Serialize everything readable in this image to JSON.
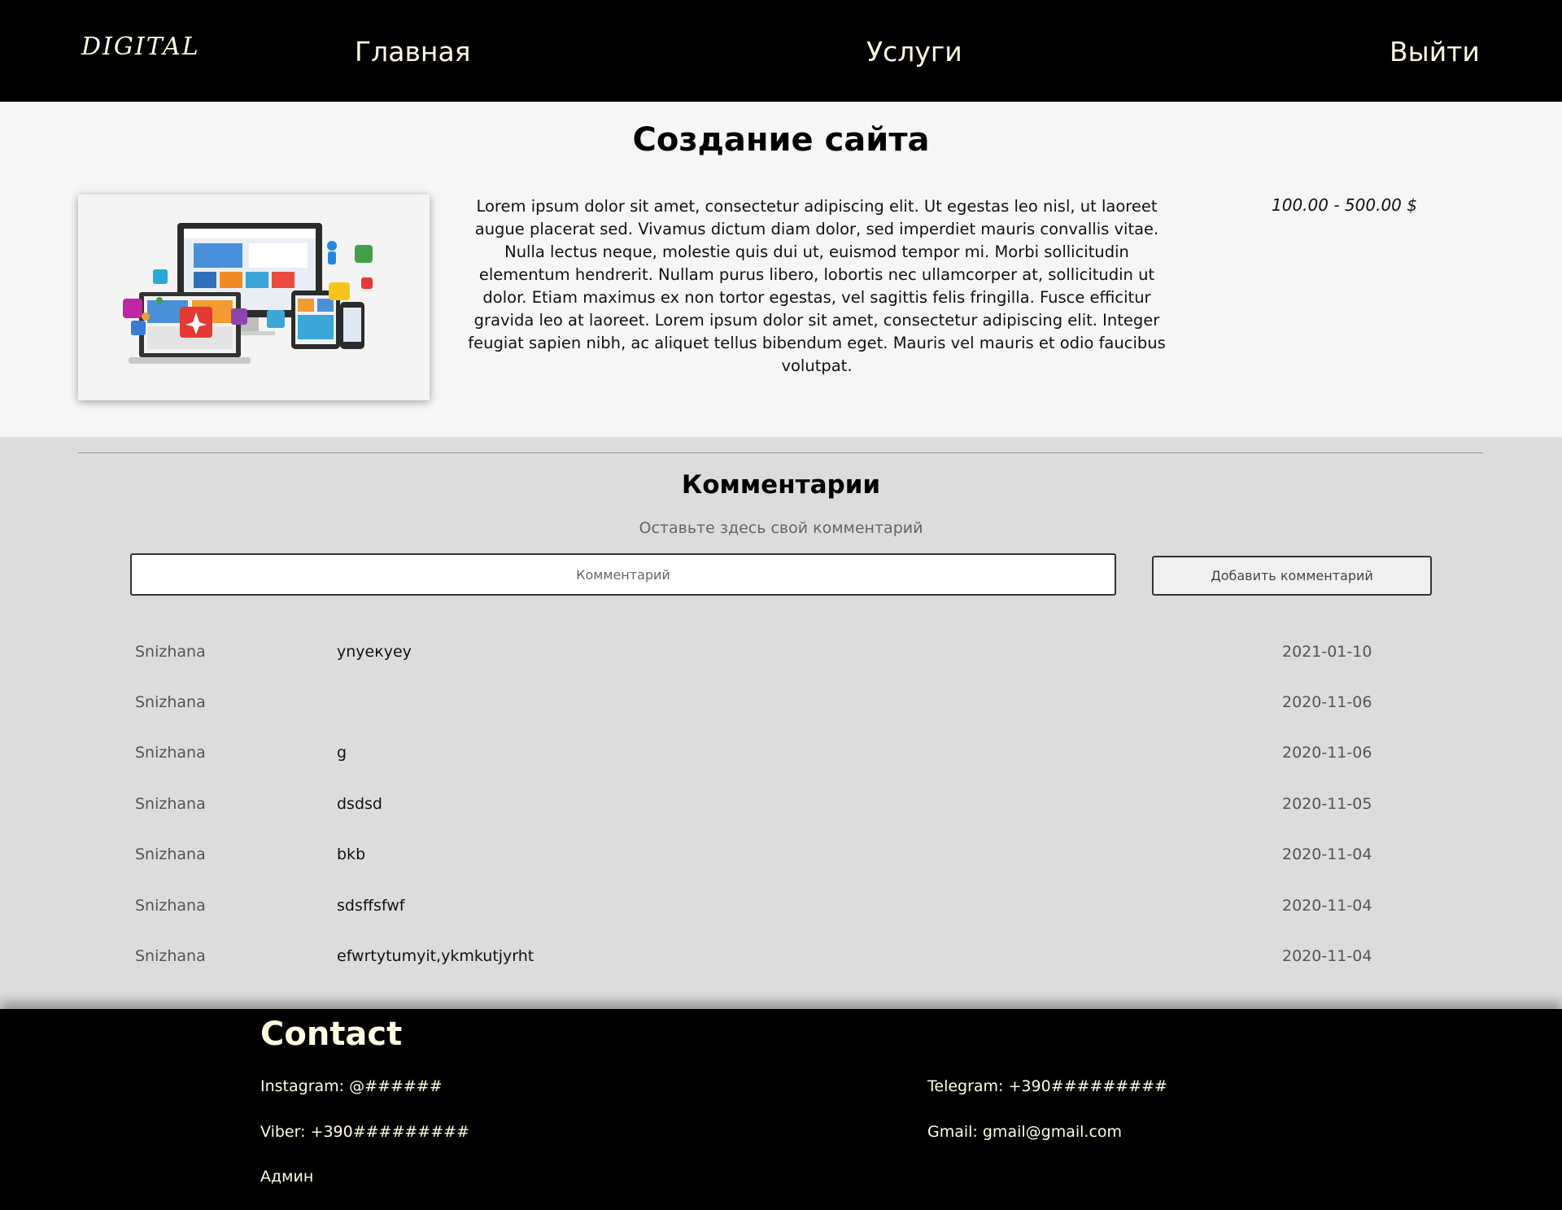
{
  "header": {
    "logo": "DIGITAL",
    "nav": {
      "home": "Главная",
      "services": "Услуги",
      "logout": "Выйти"
    }
  },
  "service": {
    "title": "Создание сайта",
    "image_icon": "devices-illustration",
    "description": "Lorem ipsum dolor sit amet, consectetur adipiscing elit. Ut egestas leo nisl, ut laoreet augue placerat sed. Vivamus dictum diam dolor, sed imperdiet mauris convallis vitae. Nulla lectus neque, molestie quis dui ut, euismod tempor mi. Morbi sollicitudin elementum hendrerit. Nullam purus libero, lobortis nec ullamcorper at, sollicitudin ut dolor. Etiam maximus ex non tortor egestas, vel sagittis felis fringilla. Fusce efficitur gravida leo at laoreet. Lorem ipsum dolor sit amet, consectetur adipiscing elit. Integer feugiat sapien nibh, ac aliquet tellus bibendum eget. Mauris vel mauris et odio faucibus volutpat.",
    "price": "100.00 - 500.00 $"
  },
  "comments": {
    "title": "Комментарии",
    "hint": "Оставьте здесь свой комментарий",
    "input_placeholder": "Комментарий",
    "input_value": "",
    "add_button": "Добавить комментарий",
    "items": [
      {
        "author": "Snizhana",
        "text": "уnуекуеу",
        "date": "2021-01-10"
      },
      {
        "author": "Snizhana",
        "text": "",
        "date": "2020-11-06"
      },
      {
        "author": "Snizhana",
        "text": "g",
        "date": "2020-11-06"
      },
      {
        "author": "Snizhana",
        "text": "dsdsd",
        "date": "2020-11-05"
      },
      {
        "author": "Snizhana",
        "text": "bkb",
        "date": "2020-11-04"
      },
      {
        "author": "Snizhana",
        "text": "sdsffsfwf",
        "date": "2020-11-04"
      },
      {
        "author": "Snizhana",
        "text": "efwrtytumyit,ykmkutjyrht",
        "date": "2020-11-04"
      }
    ]
  },
  "footer": {
    "title": "Contact",
    "instagram": "Instagram: @######",
    "telegram": "Telegram: +390#########",
    "viber": "Viber: +390#########",
    "gmail": "Gmail: gmail@gmail.com",
    "admin": "Админ"
  },
  "colors": {
    "header_bg": "#000000",
    "header_text": "#fffbe0",
    "service_bg": "#f6f6f6",
    "page_bg": "#dcdcdc",
    "footer_bg": "#000000"
  }
}
